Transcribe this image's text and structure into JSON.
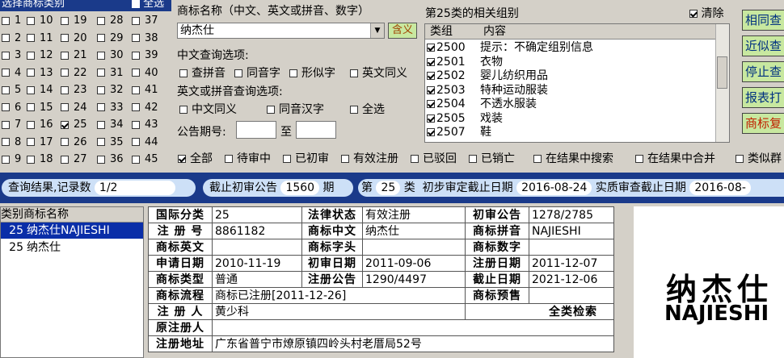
{
  "categories": {
    "header": "选择商标类别",
    "all_label": "全选",
    "all_checked": false,
    "columns": [
      [
        {
          "n": "1",
          "c": false
        },
        {
          "n": "2",
          "c": false
        },
        {
          "n": "3",
          "c": false
        },
        {
          "n": "4",
          "c": false
        },
        {
          "n": "5",
          "c": false
        },
        {
          "n": "6",
          "c": false
        },
        {
          "n": "7",
          "c": false
        },
        {
          "n": "8",
          "c": false
        },
        {
          "n": "9",
          "c": false
        }
      ],
      [
        {
          "n": "10",
          "c": false
        },
        {
          "n": "11",
          "c": false
        },
        {
          "n": "12",
          "c": false
        },
        {
          "n": "13",
          "c": false
        },
        {
          "n": "14",
          "c": false
        },
        {
          "n": "15",
          "c": false
        },
        {
          "n": "16",
          "c": false
        },
        {
          "n": "17",
          "c": false
        },
        {
          "n": "18",
          "c": false
        }
      ],
      [
        {
          "n": "19",
          "c": false
        },
        {
          "n": "20",
          "c": false
        },
        {
          "n": "21",
          "c": false
        },
        {
          "n": "22",
          "c": false
        },
        {
          "n": "23",
          "c": false
        },
        {
          "n": "24",
          "c": false
        },
        {
          "n": "25",
          "c": true
        },
        {
          "n": "26",
          "c": false
        },
        {
          "n": "27",
          "c": false
        }
      ],
      [
        {
          "n": "28",
          "c": false
        },
        {
          "n": "29",
          "c": false
        },
        {
          "n": "30",
          "c": false
        },
        {
          "n": "31",
          "c": false
        },
        {
          "n": "32",
          "c": false
        },
        {
          "n": "33",
          "c": false
        },
        {
          "n": "34",
          "c": false
        },
        {
          "n": "35",
          "c": false
        },
        {
          "n": "36",
          "c": false
        }
      ],
      [
        {
          "n": "37",
          "c": false
        },
        {
          "n": "38",
          "c": false
        },
        {
          "n": "39",
          "c": false
        },
        {
          "n": "40",
          "c": false
        },
        {
          "n": "41",
          "c": false
        },
        {
          "n": "42",
          "c": false
        },
        {
          "n": "43",
          "c": false
        },
        {
          "n": "44",
          "c": false
        },
        {
          "n": "45",
          "c": false
        }
      ]
    ]
  },
  "search": {
    "name_label": "商标名称（中文、英文或拼音、数字）",
    "name_value": "纳杰仕",
    "contain_btn": "含义",
    "cn_options_label": "中文查询选项:",
    "cn_options": [
      "查拼音",
      "同音字",
      "形似字",
      "英文同义"
    ],
    "en_options_label": "英文或拼音查询选项:",
    "en_options": [
      "中文同义",
      "同音汉字",
      "全选"
    ],
    "issue_label": "公告期号:",
    "to_label": "至"
  },
  "groups": {
    "title": "第25类的相关组别",
    "clear_label": "清除",
    "clear_checked": true,
    "col_group": "类组",
    "col_content": "内容",
    "rows": [
      {
        "code": "2500",
        "content": "提示：不确定组别信息"
      },
      {
        "code": "2501",
        "content": "衣物"
      },
      {
        "code": "2502",
        "content": "婴儿纺织用品"
      },
      {
        "code": "2503",
        "content": "特种运动服装"
      },
      {
        "code": "2504",
        "content": "不透水服装"
      },
      {
        "code": "2505",
        "content": "戏装"
      },
      {
        "code": "2507",
        "content": "鞋"
      }
    ]
  },
  "right_buttons": [
    "相同查",
    "近似查",
    "停止查",
    "报表打",
    "商标复"
  ],
  "filters": [
    {
      "label": "全部",
      "c": true
    },
    {
      "label": "待审中",
      "c": false
    },
    {
      "label": "已初审",
      "c": false
    },
    {
      "label": "有效注册",
      "c": false
    },
    {
      "label": "已驳回",
      "c": false
    },
    {
      "label": "已销亡",
      "c": false
    },
    {
      "label": "在结果中搜索",
      "c": false
    },
    {
      "label": "在结果中合并",
      "c": false
    },
    {
      "label": "类似群",
      "c": false
    }
  ],
  "status_bar": {
    "result_label": "查询结果,记录数",
    "result_value": "1/2",
    "cutoff_label": "截止初审公告",
    "cutoff_value": "1560",
    "cutoff_unit": "期",
    "class_prefix": "第",
    "class_value": "25",
    "class_suffix": "类",
    "prelim_label": "初步审定截止日期",
    "prelim_value": "2016-08-24",
    "substantive_label": "实质审查截止日期",
    "substantive_value": "2016-08-"
  },
  "results": {
    "col_class": "类别",
    "col_name": "商标名称",
    "rows": [
      {
        "cls": "25",
        "name": "纳杰仕NAJIESHI",
        "selected": true
      },
      {
        "cls": "25",
        "name": "纳杰仕",
        "selected": false
      }
    ]
  },
  "detail": {
    "intl_class_label": "国际分类",
    "intl_class": "25",
    "legal_status_label": "法律状态",
    "legal_status": "有效注册",
    "prelim_pub_label": "初审公告",
    "prelim_pub": "1278/2785",
    "reg_no_label": "注 册 号",
    "reg_no": "8861182",
    "tm_cn_label": "商标中文",
    "tm_cn": "纳杰仕",
    "tm_pinyin_label": "商标拼音",
    "tm_pinyin": "NAJIESHI",
    "tm_en_label": "商标英文",
    "tm_en": "",
    "tm_letter_label": "商标字头",
    "tm_letter": "",
    "tm_digit_label": "商标数字",
    "tm_digit": "",
    "apply_date_label": "申请日期",
    "apply_date": "2010-11-19",
    "prelim_date_label": "初审日期",
    "prelim_date": "2011-09-06",
    "reg_date_label": "注册日期",
    "reg_date": "2011-12-07",
    "tm_type_label": "商标类型",
    "tm_type": "普通",
    "reg_pub_label": "注册公告",
    "reg_pub": "1290/4497",
    "expiry_label": "截止日期",
    "expiry": "2021-12-06",
    "flow_label": "商标流程",
    "flow": "商标已注册[2011-12-26]",
    "forecast_label": "商标预售",
    "forecast": "",
    "registrant_label": "注 册 人",
    "registrant": "黄少科",
    "full_search": "全类检索",
    "orig_registrant_label": "原注册人",
    "orig_registrant": "",
    "address_label": "注册地址",
    "address": "广东省普宁市燎原镇四岭头村老厝局52号"
  },
  "logo": {
    "cn": "纳杰仕",
    "en": "NAJIESHI"
  }
}
